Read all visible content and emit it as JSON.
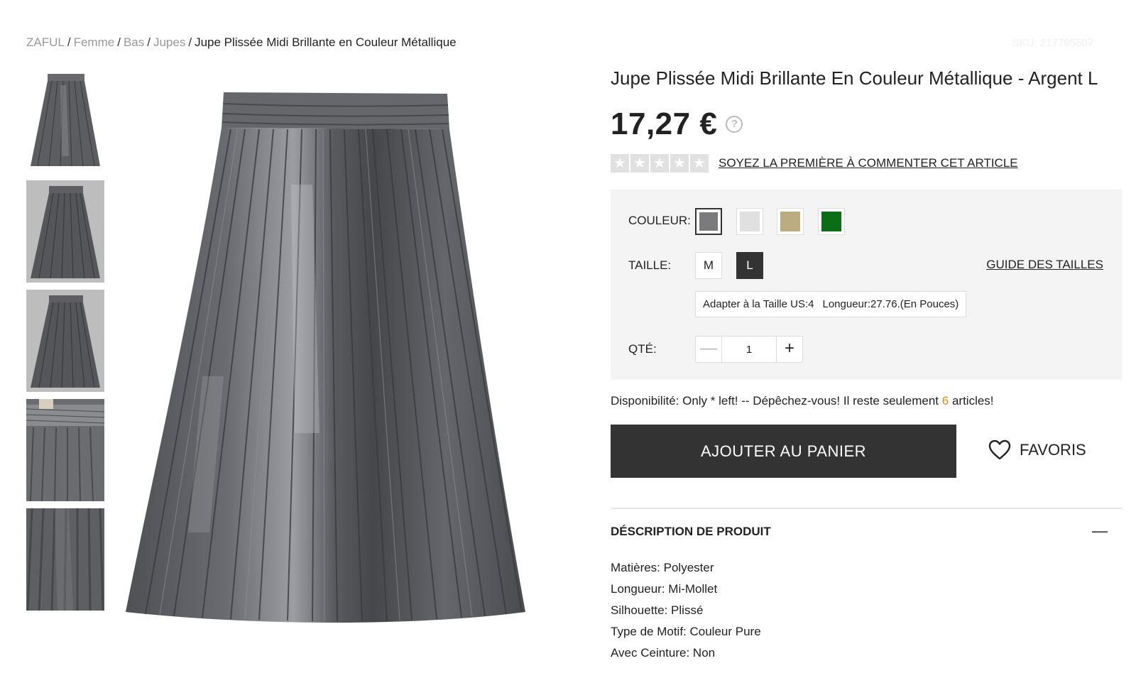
{
  "breadcrumb": {
    "items": [
      "ZAFUL",
      "Femme",
      "Bas",
      "Jupes"
    ],
    "current": "Jupe Plissée Midi Brillante en Couleur Métallique"
  },
  "sku": "SKU: 217795507",
  "product": {
    "title": "Jupe Plissée Midi Brillante En Couleur Métallique - Argent L",
    "price": "17,27 €",
    "help_symbol": "?",
    "review_link": "SOYEZ LA PREMIÈRE À COMMENTER CET ARTICLE",
    "rating_stars": 0
  },
  "options": {
    "color_label": "COULEUR:",
    "colors": [
      {
        "name": "Argent",
        "hex": "#7b7b7d",
        "selected": true
      },
      {
        "name": "light",
        "hex": "#e0e0e0",
        "selected": false
      },
      {
        "name": "gold",
        "hex": "#bcad80",
        "selected": false
      },
      {
        "name": "green",
        "hex": "#0b6e16",
        "selected": false
      }
    ],
    "size_label": "TAILLE:",
    "sizes": [
      "M",
      "L"
    ],
    "selected_size": "L",
    "size_guide": "GUIDE DES TAILLES",
    "size_note_fit": "Adapter à la Taille US:4",
    "size_note_length": "Longueur:27.76.(En Pouces)",
    "qty_label": "QTÉ:",
    "qty_value": "1",
    "qty_minus": "—",
    "qty_plus": "+"
  },
  "availability": {
    "prefix": "Disponibilité: Only * left! -- Dépêchez-vous! Il reste seulement ",
    "count": "6",
    "suffix": " articles!"
  },
  "actions": {
    "add_to_cart": "AJOUTER AU PANIER",
    "favorites": "FAVORIS"
  },
  "description": {
    "header": "DÉSCRIPTION DE PRODUIT",
    "collapse_symbol": "—",
    "items": [
      "Matières: Polyester",
      "Longueur: Mi-Mollet",
      "Silhouette: Plissé",
      "Type de Motif: Couleur Pure",
      "Avec Ceinture: Non"
    ]
  },
  "colors": {
    "button_dark": "#333333",
    "options_bg": "#f4f4f4",
    "accent_count": "#e08a1e",
    "skirt": "#5c5d61"
  }
}
